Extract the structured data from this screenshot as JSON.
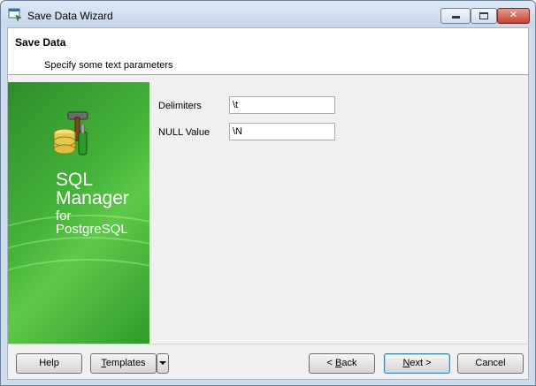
{
  "window": {
    "title": "Save Data Wizard",
    "controls": {
      "minimize": "minimize",
      "maximize": "maximize",
      "close": "close"
    }
  },
  "header": {
    "title": "Save Data",
    "subtitle": "Specify some text parameters"
  },
  "banner": {
    "line1": "SQL",
    "line2": "Manager",
    "line3": "for",
    "line4": "PostgreSQL",
    "icon": "database-tools-icon",
    "colors": {
      "green_dark": "#2d8e2a",
      "green_light": "#5fc94a"
    }
  },
  "form": {
    "delimiters": {
      "label": "Delimiters",
      "value": "\\t"
    },
    "null_value": {
      "label": "NULL Value",
      "value": "\\N"
    }
  },
  "footer": {
    "help_label": "Help",
    "templates_prefix": "",
    "templates_accel": "T",
    "templates_rest": "emplates",
    "back_prefix": "< ",
    "back_accel": "B",
    "back_rest": "ack",
    "next_prefix": "",
    "next_accel": "N",
    "next_rest": "ext >",
    "cancel_label": "Cancel"
  },
  "colors": {
    "frame": "#cfdcec",
    "client": "#f0f0f0",
    "close_button": "#c5422f",
    "default_button_border": "#3c7fb1"
  }
}
